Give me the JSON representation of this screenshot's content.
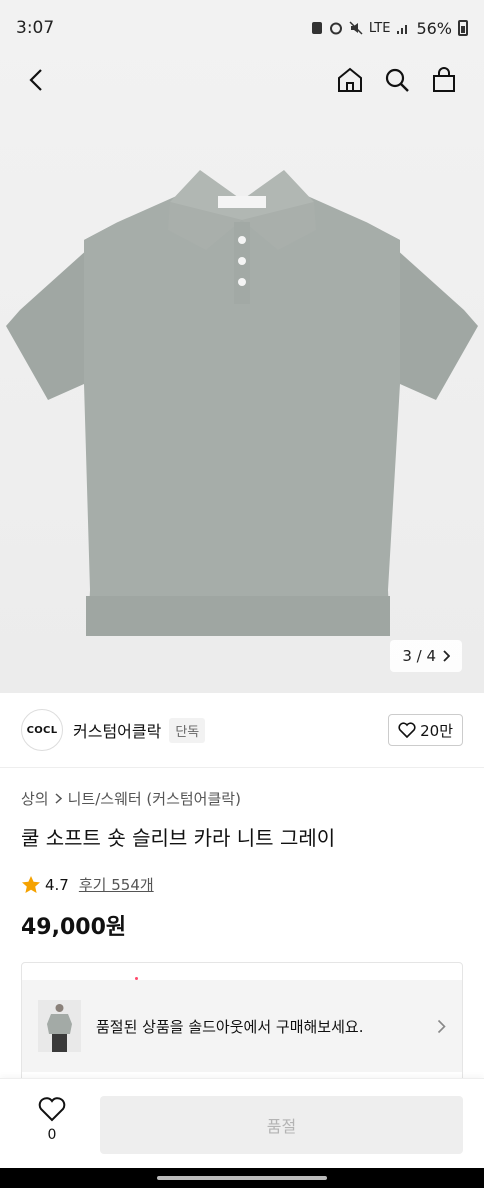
{
  "status": {
    "time": "3:07",
    "network": "LTE",
    "battery": "56%",
    "icons": [
      "notification-icon",
      "alarm-icon",
      "mute-icon",
      "lte-icon",
      "signal-icon",
      "battery-icon"
    ]
  },
  "nav": {
    "icons": [
      "back-icon",
      "home-icon",
      "search-icon",
      "cart-icon"
    ]
  },
  "gallery": {
    "counter": "3 / 4"
  },
  "brand": {
    "logo_text": "COCL",
    "name": "커스텀어클락",
    "tag": "단독",
    "likes": "20만"
  },
  "product": {
    "breadcrumb": [
      "상의",
      "니트/스웨터 (커스텀어클락)"
    ],
    "title": "쿨 소프트 숏 슬리브 카라 니트 그레이",
    "rating": "4.7",
    "reviews": "후기 554개",
    "price": "49,000원"
  },
  "soldout": {
    "text": "품절된 상품을 솔드아웃에서 구매해보세요."
  },
  "bottom": {
    "wish_count": "0",
    "buy_label": "품절"
  },
  "colors": {
    "accent_star": "#f5a200",
    "disabled_button": "#eeeeee",
    "shirt_gray": "#a3aaa6"
  }
}
